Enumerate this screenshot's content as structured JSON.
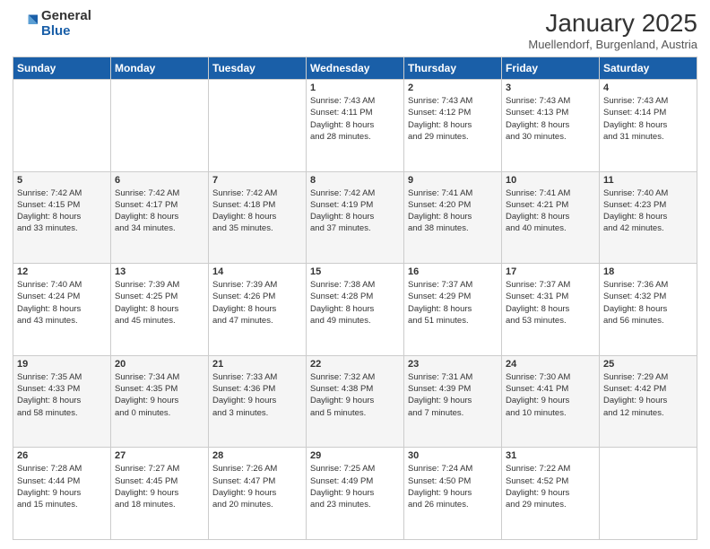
{
  "logo": {
    "general": "General",
    "blue": "Blue"
  },
  "header": {
    "title": "January 2025",
    "subtitle": "Muellendorf, Burgenland, Austria"
  },
  "weekdays": [
    "Sunday",
    "Monday",
    "Tuesday",
    "Wednesday",
    "Thursday",
    "Friday",
    "Saturday"
  ],
  "weeks": [
    [
      {
        "day": "",
        "info": ""
      },
      {
        "day": "",
        "info": ""
      },
      {
        "day": "",
        "info": ""
      },
      {
        "day": "1",
        "info": "Sunrise: 7:43 AM\nSunset: 4:11 PM\nDaylight: 8 hours\nand 28 minutes."
      },
      {
        "day": "2",
        "info": "Sunrise: 7:43 AM\nSunset: 4:12 PM\nDaylight: 8 hours\nand 29 minutes."
      },
      {
        "day": "3",
        "info": "Sunrise: 7:43 AM\nSunset: 4:13 PM\nDaylight: 8 hours\nand 30 minutes."
      },
      {
        "day": "4",
        "info": "Sunrise: 7:43 AM\nSunset: 4:14 PM\nDaylight: 8 hours\nand 31 minutes."
      }
    ],
    [
      {
        "day": "5",
        "info": "Sunrise: 7:42 AM\nSunset: 4:15 PM\nDaylight: 8 hours\nand 33 minutes."
      },
      {
        "day": "6",
        "info": "Sunrise: 7:42 AM\nSunset: 4:17 PM\nDaylight: 8 hours\nand 34 minutes."
      },
      {
        "day": "7",
        "info": "Sunrise: 7:42 AM\nSunset: 4:18 PM\nDaylight: 8 hours\nand 35 minutes."
      },
      {
        "day": "8",
        "info": "Sunrise: 7:42 AM\nSunset: 4:19 PM\nDaylight: 8 hours\nand 37 minutes."
      },
      {
        "day": "9",
        "info": "Sunrise: 7:41 AM\nSunset: 4:20 PM\nDaylight: 8 hours\nand 38 minutes."
      },
      {
        "day": "10",
        "info": "Sunrise: 7:41 AM\nSunset: 4:21 PM\nDaylight: 8 hours\nand 40 minutes."
      },
      {
        "day": "11",
        "info": "Sunrise: 7:40 AM\nSunset: 4:23 PM\nDaylight: 8 hours\nand 42 minutes."
      }
    ],
    [
      {
        "day": "12",
        "info": "Sunrise: 7:40 AM\nSunset: 4:24 PM\nDaylight: 8 hours\nand 43 minutes."
      },
      {
        "day": "13",
        "info": "Sunrise: 7:39 AM\nSunset: 4:25 PM\nDaylight: 8 hours\nand 45 minutes."
      },
      {
        "day": "14",
        "info": "Sunrise: 7:39 AM\nSunset: 4:26 PM\nDaylight: 8 hours\nand 47 minutes."
      },
      {
        "day": "15",
        "info": "Sunrise: 7:38 AM\nSunset: 4:28 PM\nDaylight: 8 hours\nand 49 minutes."
      },
      {
        "day": "16",
        "info": "Sunrise: 7:37 AM\nSunset: 4:29 PM\nDaylight: 8 hours\nand 51 minutes."
      },
      {
        "day": "17",
        "info": "Sunrise: 7:37 AM\nSunset: 4:31 PM\nDaylight: 8 hours\nand 53 minutes."
      },
      {
        "day": "18",
        "info": "Sunrise: 7:36 AM\nSunset: 4:32 PM\nDaylight: 8 hours\nand 56 minutes."
      }
    ],
    [
      {
        "day": "19",
        "info": "Sunrise: 7:35 AM\nSunset: 4:33 PM\nDaylight: 8 hours\nand 58 minutes."
      },
      {
        "day": "20",
        "info": "Sunrise: 7:34 AM\nSunset: 4:35 PM\nDaylight: 9 hours\nand 0 minutes."
      },
      {
        "day": "21",
        "info": "Sunrise: 7:33 AM\nSunset: 4:36 PM\nDaylight: 9 hours\nand 3 minutes."
      },
      {
        "day": "22",
        "info": "Sunrise: 7:32 AM\nSunset: 4:38 PM\nDaylight: 9 hours\nand 5 minutes."
      },
      {
        "day": "23",
        "info": "Sunrise: 7:31 AM\nSunset: 4:39 PM\nDaylight: 9 hours\nand 7 minutes."
      },
      {
        "day": "24",
        "info": "Sunrise: 7:30 AM\nSunset: 4:41 PM\nDaylight: 9 hours\nand 10 minutes."
      },
      {
        "day": "25",
        "info": "Sunrise: 7:29 AM\nSunset: 4:42 PM\nDaylight: 9 hours\nand 12 minutes."
      }
    ],
    [
      {
        "day": "26",
        "info": "Sunrise: 7:28 AM\nSunset: 4:44 PM\nDaylight: 9 hours\nand 15 minutes."
      },
      {
        "day": "27",
        "info": "Sunrise: 7:27 AM\nSunset: 4:45 PM\nDaylight: 9 hours\nand 18 minutes."
      },
      {
        "day": "28",
        "info": "Sunrise: 7:26 AM\nSunset: 4:47 PM\nDaylight: 9 hours\nand 20 minutes."
      },
      {
        "day": "29",
        "info": "Sunrise: 7:25 AM\nSunset: 4:49 PM\nDaylight: 9 hours\nand 23 minutes."
      },
      {
        "day": "30",
        "info": "Sunrise: 7:24 AM\nSunset: 4:50 PM\nDaylight: 9 hours\nand 26 minutes."
      },
      {
        "day": "31",
        "info": "Sunrise: 7:22 AM\nSunset: 4:52 PM\nDaylight: 9 hours\nand 29 minutes."
      },
      {
        "day": "",
        "info": ""
      }
    ]
  ]
}
